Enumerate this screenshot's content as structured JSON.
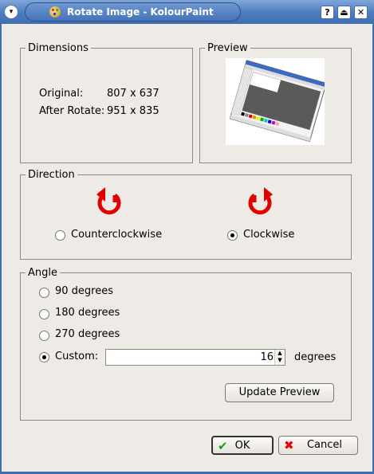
{
  "window": {
    "title": "Rotate Image - KolourPaint",
    "menu_glyph": "▾",
    "help_glyph": "?",
    "shade_glyph": "⏏",
    "close_glyph": "✕"
  },
  "dimensions": {
    "title": "Dimensions",
    "original_label": "Original:",
    "original_value": "807 x 637",
    "after_label": "After Rotate:",
    "after_value": "951 x 835"
  },
  "preview": {
    "title": "Preview"
  },
  "direction": {
    "title": "Direction",
    "counterclockwise_label": "Counterclockwise",
    "clockwise_label": "Clockwise",
    "selected": "clockwise",
    "arrow_color": "#e30000"
  },
  "angle": {
    "title": "Angle",
    "options": [
      "90 degrees",
      "180 degrees",
      "270 degrees"
    ],
    "custom_label": "Custom:",
    "custom_value": "16",
    "units_label": "degrees",
    "selected": "custom",
    "update_preview_label": "Update Preview"
  },
  "footer": {
    "ok_label": "OK",
    "cancel_label": "Cancel"
  },
  "colors": {
    "titlebar": "#4d7bbf",
    "background": "#eeeae5"
  }
}
